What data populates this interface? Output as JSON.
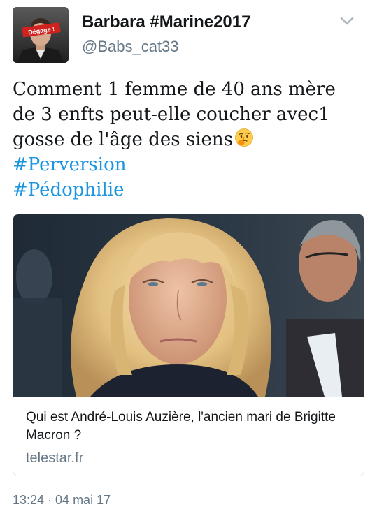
{
  "user": {
    "display_name": "Barbara #Marine2017",
    "handle": "@Babs_cat33",
    "avatar_badge": "Dégage !"
  },
  "menu": {
    "icon": "chevron-down-icon"
  },
  "tweet": {
    "lines": [
      "Comment 1 femme de 40 ans mère",
      "de 3 enfts peut-elle coucher avec1",
      "gosse de l'âge des siens"
    ],
    "emoji": "thinking-face-emoji",
    "hashtags": [
      "#Perversion",
      "#Pédophilie"
    ]
  },
  "card": {
    "title": "Qui est André-Louis Auzière, l'ancien mari de Brigitte Macron ?",
    "domain": "telestar.fr"
  },
  "timestamp": "13:24 · 04 mai 17",
  "colors": {
    "link": "#1b95e0",
    "secondary_text": "#657786",
    "primary_text": "#14171a",
    "border": "#e1e8ed",
    "badge_red": "#d0231f"
  }
}
